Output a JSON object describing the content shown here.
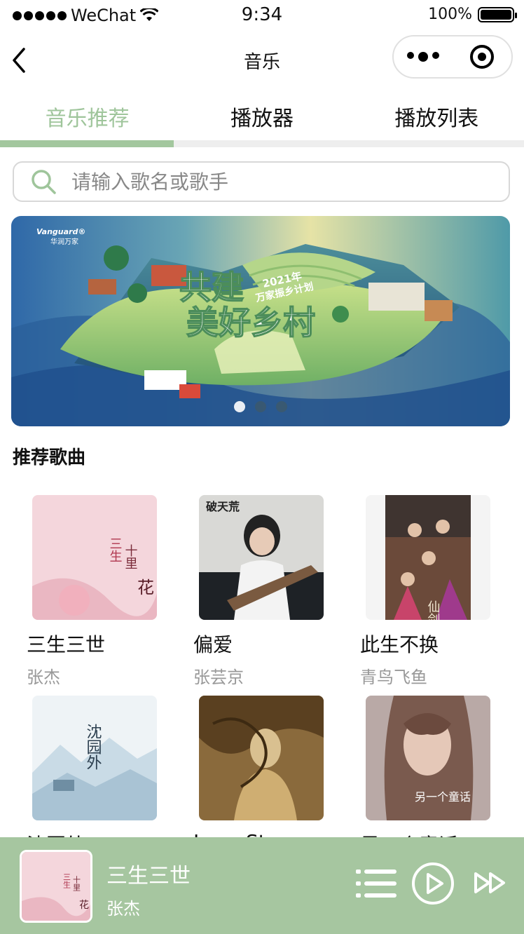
{
  "status": {
    "carrier": "WeChat",
    "time": "9:34",
    "battery": "100%"
  },
  "nav": {
    "title": "音乐"
  },
  "tabs": [
    {
      "label": "音乐推荐",
      "active": true
    },
    {
      "label": "播放器",
      "active": false
    },
    {
      "label": "播放列表",
      "active": false
    }
  ],
  "search": {
    "placeholder": "请输入歌名或歌手"
  },
  "banner": {
    "logo": "Vanguard 华润万家",
    "year_text": "2021年 万家振乡计划",
    "headline": "共建美好乡村",
    "slide_count": 3,
    "active_slide": 1
  },
  "section": {
    "title": "推荐歌曲"
  },
  "songs": [
    {
      "title": "三生三世",
      "artist": "张杰",
      "cover_text": "三生三世 十里桃花"
    },
    {
      "title": "偏爱",
      "artist": "张芸京",
      "cover_text": "破天荒 张芸京"
    },
    {
      "title": "此生不换",
      "artist": "青鸟飞鱼",
      "cover_text": "仙剑奇侠传"
    },
    {
      "title": "沈园外",
      "artist": "",
      "cover_text": "沈园外"
    },
    {
      "title": "Love Story",
      "artist": "",
      "cover_text": ""
    },
    {
      "title": "另一个童话",
      "artist": "",
      "cover_text": "另一个童话 G.E.M."
    }
  ],
  "player": {
    "title": "三生三世",
    "artist": "张杰"
  },
  "colors": {
    "accent": "#9fc59b",
    "player_bg": "#a6c6a0"
  }
}
